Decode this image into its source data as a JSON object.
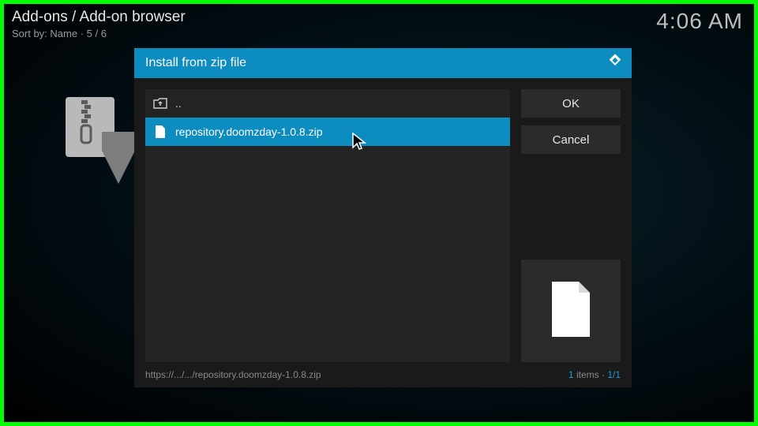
{
  "header": {
    "breadcrumb": "Add-ons / Add-on browser",
    "sortline": "Sort by: Name  ·  5 / 6",
    "clock": "4:06 AM"
  },
  "dialog": {
    "title": "Install from zip file",
    "rows": {
      "parent": {
        "label": ".."
      },
      "selected": {
        "label": "repository.doomzday-1.0.8.zip"
      }
    },
    "buttons": {
      "ok": "OK",
      "cancel": "Cancel"
    },
    "footer": {
      "path": "https://.../.../repository.doomzday-1.0.8.zip",
      "count_label": "items",
      "count_value": "1",
      "page": "1/1"
    }
  }
}
